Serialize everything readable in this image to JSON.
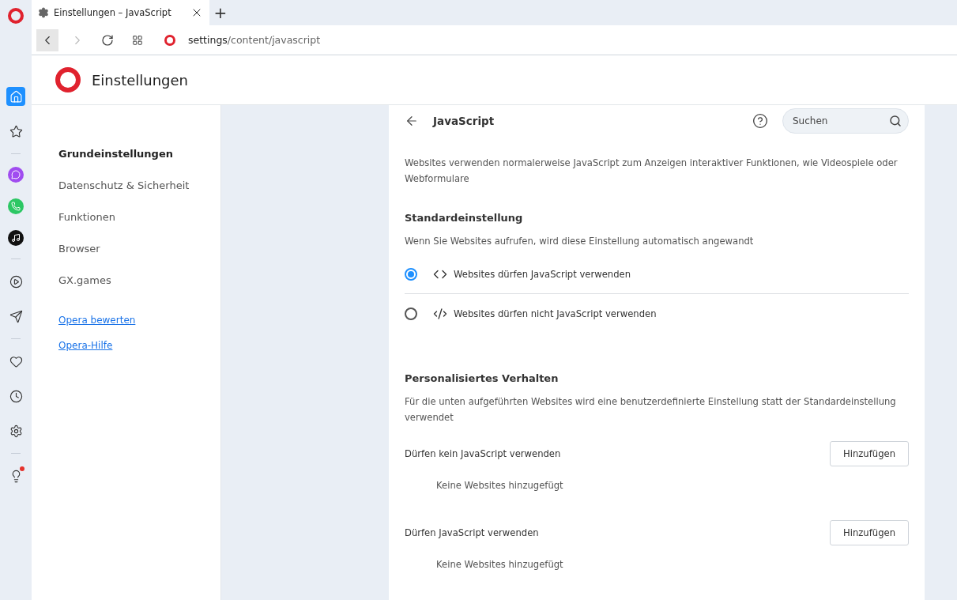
{
  "sidebar": {
    "items": [
      {
        "kind": "home",
        "selected": true
      },
      {
        "kind": "star",
        "selected": false
      },
      {
        "kind": "separator"
      },
      {
        "kind": "messenger"
      },
      {
        "kind": "whatsapp"
      },
      {
        "kind": "tiktok"
      },
      {
        "kind": "separator"
      },
      {
        "kind": "player",
        "selected": false
      },
      {
        "kind": "send",
        "selected": false
      },
      {
        "kind": "separator"
      },
      {
        "kind": "heart",
        "selected": false
      },
      {
        "kind": "clock",
        "selected": false
      },
      {
        "kind": "settings",
        "selected": false
      },
      {
        "kind": "separator"
      },
      {
        "kind": "tips",
        "selected": false,
        "notification": true
      }
    ]
  },
  "tab": {
    "title": "Einstellungen – JavaScript",
    "new_tab": "+"
  },
  "address_bar": {
    "host": "settings",
    "path": "/content/javascript",
    "back_enabled": true,
    "forward_enabled": false
  },
  "header": {
    "title": "Einstellungen"
  },
  "nav": {
    "items": [
      {
        "label": "Grundeinstellungen",
        "selected": true
      },
      {
        "label": "Datenschutz & Sicherheit",
        "selected": false
      },
      {
        "label": "Funktionen",
        "selected": false
      },
      {
        "label": "Browser",
        "selected": false
      },
      {
        "label": "GX.games",
        "selected": false
      }
    ],
    "links": [
      "Opera bewerten",
      "Opera-Hilfe"
    ]
  },
  "page": {
    "title": "JavaScript",
    "search": {
      "placeholder": "Suchen"
    },
    "description": "Websites verwenden normalerweise JavaScript zum Anzeigen interaktiver Funktionen, wie Videospiele oder Webformulare",
    "default_section": {
      "title": "Standardeinstellung",
      "subtitle": "Wenn Sie Websites aufrufen, wird diese Einstellung automatisch angewandt",
      "options": [
        {
          "label": "Websites dürfen JavaScript verwenden",
          "kind": "allow",
          "selected": true
        },
        {
          "label": "Websites dürfen nicht JavaScript verwenden",
          "kind": "block",
          "selected": false
        }
      ]
    },
    "custom_section": {
      "title": "Personalisiertes Verhalten",
      "subtitle": "Für die unten aufgeführten Websites wird eine benutzerdefinierte Einstellung statt der Standardeinstellung verwendet",
      "lists": [
        {
          "title": "Dürfen kein JavaScript verwenden",
          "button": "Hinzufügen",
          "empty": "Keine Websites hinzugefügt"
        },
        {
          "title": "Dürfen JavaScript verwenden",
          "button": "Hinzufügen",
          "empty": "Keine Websites hinzugefügt"
        }
      ]
    }
  }
}
